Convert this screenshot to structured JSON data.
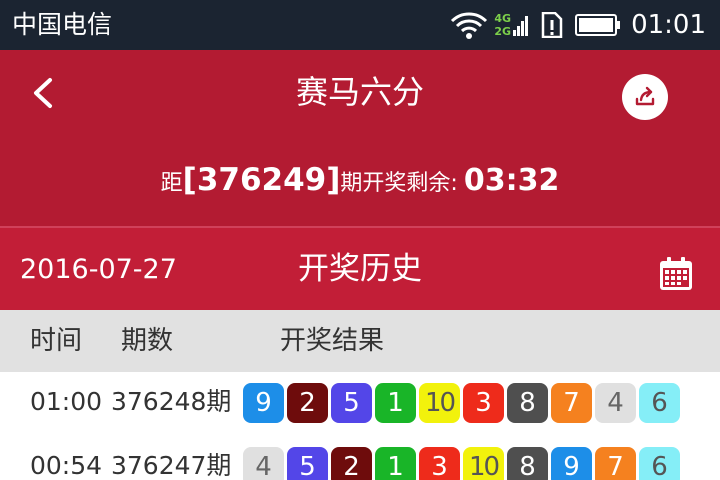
{
  "status": {
    "carrier": "中国电信",
    "net_top": "4G",
    "net_bottom": "2G",
    "time": "01:01"
  },
  "header": {
    "title": "赛马六分",
    "countdown": {
      "prefix": "距",
      "issue": "[376249]",
      "suffix": "期开奖剩余:",
      "time": "03:32"
    }
  },
  "subheader": {
    "date": "2016-07-27",
    "title": "开奖历史"
  },
  "columns": {
    "time": "时间",
    "issue": "期数",
    "result": "开奖结果"
  },
  "rows": [
    {
      "time": "01:00",
      "issue": "376248期",
      "balls": [
        "9",
        "2",
        "5",
        "1",
        "10",
        "3",
        "8",
        "7",
        "4",
        "6"
      ]
    },
    {
      "time": "00:54",
      "issue": "376247期",
      "balls": [
        "4",
        "5",
        "2",
        "1",
        "3",
        "10",
        "8",
        "9",
        "7",
        "6"
      ]
    }
  ],
  "ball_colors": {
    "1": {
      "bg": "#19b528",
      "fg": "#ffffff"
    },
    "2": {
      "bg": "#6e0c0c",
      "fg": "#ffffff"
    },
    "3": {
      "bg": "#ee2b1b",
      "fg": "#ffffff"
    },
    "4": {
      "bg": "#e0e0e0",
      "fg": "#666666"
    },
    "5": {
      "bg": "#5346e8",
      "fg": "#ffffff"
    },
    "6": {
      "bg": "#85eef7",
      "fg": "#555555"
    },
    "7": {
      "bg": "#f5811f",
      "fg": "#ffffff"
    },
    "8": {
      "bg": "#4f4f4f",
      "fg": "#ffffff"
    },
    "9": {
      "bg": "#1d8ee8",
      "fg": "#ffffff"
    },
    "10": {
      "bg": "#f2f20c",
      "fg": "#555555"
    }
  },
  "colors": {
    "header_bg": "#b31b32",
    "subheader_bg": "#c21e37",
    "statusbar_bg": "#1b2431"
  },
  "icons": {
    "back": "chevron-left-icon",
    "share": "share-icon",
    "calendar": "calendar-icon"
  }
}
